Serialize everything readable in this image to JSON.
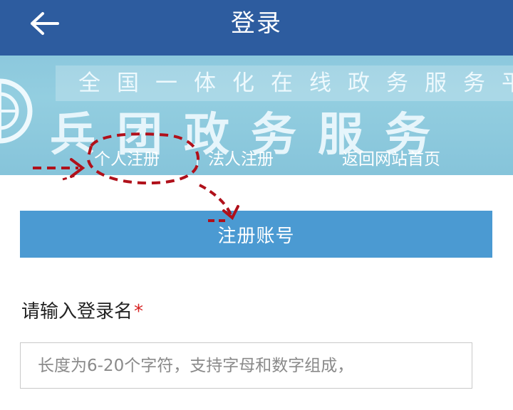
{
  "header": {
    "title": "登录",
    "back_icon": "arrow-left-icon",
    "background_color": "#2d5c9f"
  },
  "banner": {
    "subtitle": "全国一体化在线政务服务平",
    "title": "兵团政务服务",
    "nav": {
      "personal_register": "个人注册",
      "legal_register": "法人注册",
      "return_home": "返回网站首页"
    },
    "background_color": "#8cc8dd"
  },
  "register_button": {
    "label": "注册账号",
    "color": "#4b9ad2"
  },
  "form": {
    "login_name_label": "请输入登录名",
    "required_mark": "*",
    "login_name_placeholder": "长度为6-20个字符，支持字母和数字组成，",
    "login_name_value": ""
  },
  "annotation": {
    "color": "#b0101a",
    "description_icon": "dashed-arrow-icon"
  }
}
